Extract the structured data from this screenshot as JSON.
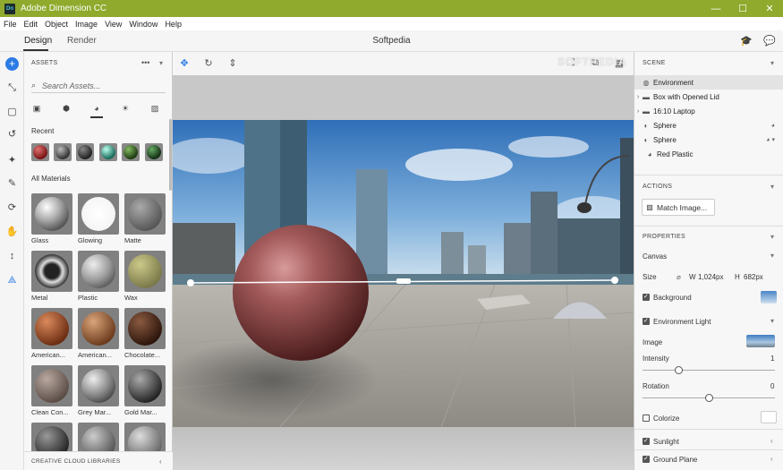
{
  "window": {
    "app_icon": "Dn",
    "title": "Adobe Dimension CC",
    "minimize": "—",
    "maximize": "☐",
    "close": "✕"
  },
  "menu": [
    "File",
    "Edit",
    "Object",
    "Image",
    "View",
    "Window",
    "Help"
  ],
  "modes": {
    "design": "Design",
    "render": "Render",
    "document": "Softpedia"
  },
  "assets": {
    "header": "ASSETS",
    "search_placeholder": "Search Assets...",
    "recent_label": "Recent",
    "all_materials_label": "All Materials",
    "materials": [
      "Glass",
      "Glowing",
      "Matte",
      "Metal",
      "Plastic",
      "Wax",
      "American...",
      "American...",
      "Chocolate...",
      "Clean Con...",
      "Grey Mar...",
      "Gold Mar...",
      "",
      "",
      ""
    ],
    "libraries_label": "CREATIVE CLOUD LIBRARIES"
  },
  "scene_panel": {
    "header": "SCENE",
    "items": [
      {
        "label": "Environment",
        "icon": "globe-icon",
        "selected": true
      },
      {
        "label": "Box with Opened Lid",
        "icon": "folder-icon",
        "expand": "›"
      },
      {
        "label": "16:10 Laptop",
        "icon": "folder-icon",
        "expand": "›"
      },
      {
        "label": "Sphere",
        "icon": "sphere-icon"
      },
      {
        "label": "Sphere",
        "icon": "sphere-icon",
        "expand_down": "▾"
      },
      {
        "label": "Red Plastic",
        "icon": "material-icon",
        "indent": true
      }
    ]
  },
  "actions": {
    "header": "ACTIONS",
    "match_image": "Match Image..."
  },
  "properties": {
    "header": "PROPERTIES",
    "canvas": "Canvas",
    "size_label": "Size",
    "w_label": "W",
    "w_value": "1,024px",
    "h_label": "H",
    "h_value": "682px",
    "background": "Background",
    "environment_light": "Environment Light",
    "image": "Image",
    "intensity": "Intensity",
    "intensity_value": "1",
    "intensity_fraction": 0.07,
    "rotation": "Rotation",
    "rotation_value": "0",
    "rotation_fraction": 0.5,
    "colorize": "Colorize",
    "sunlight": "Sunlight",
    "ground_plane": "Ground Plane"
  },
  "watermark": "SOFTPEDIA",
  "colors": {
    "titlebar": "#8faa2c",
    "accent": "#2c7be5"
  }
}
